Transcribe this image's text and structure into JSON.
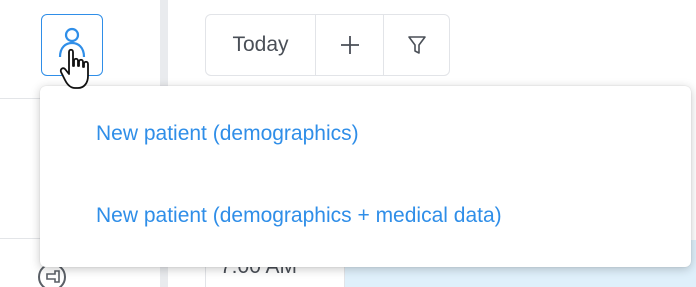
{
  "toolbar": {
    "today_label": "Today",
    "add_icon": "plus-icon",
    "filter_icon": "filter-icon"
  },
  "sidebar": {
    "add_patient_icon": "person-icon",
    "pin_icon": "pin-icon"
  },
  "calendar": {
    "time_label": "7:00 AM"
  },
  "dropdown": {
    "items": [
      {
        "label": "New patient (demographics)"
      },
      {
        "label": "New patient (demographics + medical data)"
      }
    ]
  },
  "colors": {
    "accent": "#2f8ee8",
    "text": "#4a4f57",
    "event_bg": "#dff0fb",
    "border": "#e2e4e8"
  }
}
